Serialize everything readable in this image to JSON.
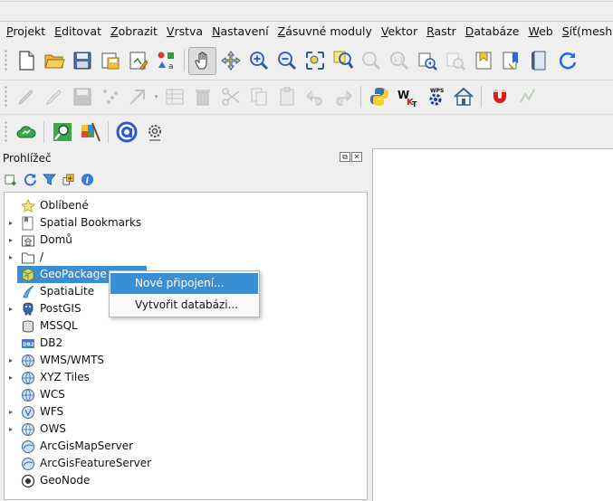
{
  "menubar": {
    "items": [
      {
        "label": "Projekt",
        "u": "P",
        "rest": "rojekt"
      },
      {
        "label": "Editovat",
        "u": "E",
        "rest": "ditovat"
      },
      {
        "label": "Zobrazit",
        "u": "Z",
        "rest": "obrazit"
      },
      {
        "label": "Vrstva",
        "u": "V",
        "rest": "rstva"
      },
      {
        "label": "Nastavení",
        "u": "N",
        "rest": "astavení"
      },
      {
        "label": "Zásuvné moduly",
        "u": "Z",
        "rest": "ásuvné moduly"
      },
      {
        "label": "Vektor",
        "u": "V",
        "rest": "ektor"
      },
      {
        "label": "Rastr",
        "u": "R",
        "rest": "astr"
      },
      {
        "label": "Databáze",
        "u": "D",
        "rest": "atabáze"
      },
      {
        "label": "Web",
        "u": "W",
        "rest": "eb"
      },
      {
        "label": "Síť(mesh)",
        "u": "S",
        "rest": "íť(mesh)"
      }
    ]
  },
  "browser": {
    "title": "Prohlížeč",
    "float_glyph": "⧉",
    "close_glyph": "✕",
    "items": [
      {
        "label": "Oblíbené",
        "icon": "star-icon",
        "expand": false
      },
      {
        "label": "Spatial Bookmarks",
        "icon": "bookmark-icon",
        "expand": true
      },
      {
        "label": "Domů",
        "icon": "home-folder-icon",
        "expand": true
      },
      {
        "label": "/",
        "icon": "folder-icon",
        "expand": true
      },
      {
        "label": "GeoPackage",
        "icon": "geopackage-icon",
        "expand": false,
        "selected": true
      },
      {
        "label": "SpatiaLite",
        "icon": "spatialite-icon",
        "expand": false
      },
      {
        "label": "PostGIS",
        "icon": "postgis-icon",
        "expand": true
      },
      {
        "label": "MSSQL",
        "icon": "mssql-icon",
        "expand": false
      },
      {
        "label": "DB2",
        "icon": "db2-icon",
        "expand": false
      },
      {
        "label": "WMS/WMTS",
        "icon": "wms-icon",
        "expand": true
      },
      {
        "label": "XYZ Tiles",
        "icon": "xyz-icon",
        "expand": true
      },
      {
        "label": "WCS",
        "icon": "wcs-icon",
        "expand": false
      },
      {
        "label": "WFS",
        "icon": "wfs-icon",
        "expand": true
      },
      {
        "label": "OWS",
        "icon": "ows-icon",
        "expand": true
      },
      {
        "label": "ArcGisMapServer",
        "icon": "arcgis-mapserver-icon",
        "expand": false
      },
      {
        "label": "ArcGisFeatureServer",
        "icon": "arcgis-featureserver-icon",
        "expand": false
      },
      {
        "label": "GeoNode",
        "icon": "geonode-icon",
        "expand": false
      }
    ]
  },
  "context_menu": {
    "items": [
      {
        "label": "Nové připojení...",
        "highlighted": true
      },
      {
        "label": "Vytvořit databázi...",
        "highlighted": false
      }
    ]
  },
  "toolbar_icons": {
    "row1": [
      "new-project-icon",
      "open-project-icon",
      "save-project-icon",
      "save-as-icon",
      "print-layout-icon",
      "style-manager-icon",
      "pan-icon",
      "pan-to-selection-icon",
      "zoom-in-icon",
      "zoom-out-icon",
      "zoom-full-icon",
      "zoom-to-selection-icon",
      "zoom-to-layer-icon",
      "zoom-native-icon",
      "zoom-last-icon",
      "zoom-next-icon",
      "new-bookmark-icon",
      "show-bookmarks-icon",
      "new-map-view-icon",
      "refresh-icon"
    ],
    "row2": [
      "digitize-icon",
      "edit-pencil-icon",
      "save-edits-icon",
      "vertex-tool-icon",
      "move-feature-icon",
      "attribute-table-icon",
      "delete-selected-icon",
      "cut-icon",
      "copy-icon",
      "paste-icon",
      "undo-icon",
      "redo-icon",
      "python-console-icon",
      "wkt-icon",
      "wps-icon",
      "home-plugin-icon",
      "magnet-icon",
      "advanced-digitize-icon"
    ],
    "row3": [
      "cloud-plugin-icon",
      "locator-icon",
      "qgis-plugin-icon",
      "a-logo-icon",
      "settings-gear-icon"
    ]
  },
  "colors": {
    "selection": "#3a8fd3",
    "background": "#efefef"
  }
}
